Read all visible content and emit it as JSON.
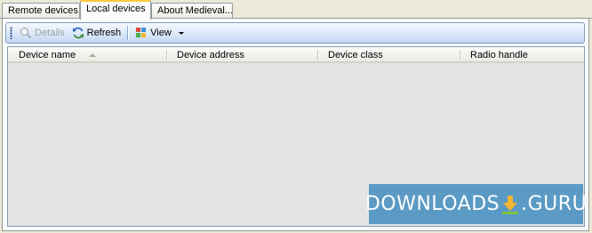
{
  "tabs": [
    {
      "label": "Remote devices",
      "active": false
    },
    {
      "label": "Local devices",
      "active": true
    },
    {
      "label": "About Medieval...",
      "active": false
    }
  ],
  "toolbar": {
    "details_label": "Details",
    "refresh_label": "Refresh",
    "view_label": "View"
  },
  "device_list": {
    "columns": [
      "Device name",
      "Device address",
      "Device class",
      "Radio handle"
    ],
    "sorted_column": "Device name",
    "rows": []
  },
  "watermark": {
    "left": "DOWNLOADS",
    "right": ".GURU"
  },
  "colors": {
    "tab_highlight": "#ffc83c",
    "toolbar_border": "#7b9ebd",
    "list_background": "#e4e4e4",
    "watermark_bg": "#5b9ac4"
  }
}
